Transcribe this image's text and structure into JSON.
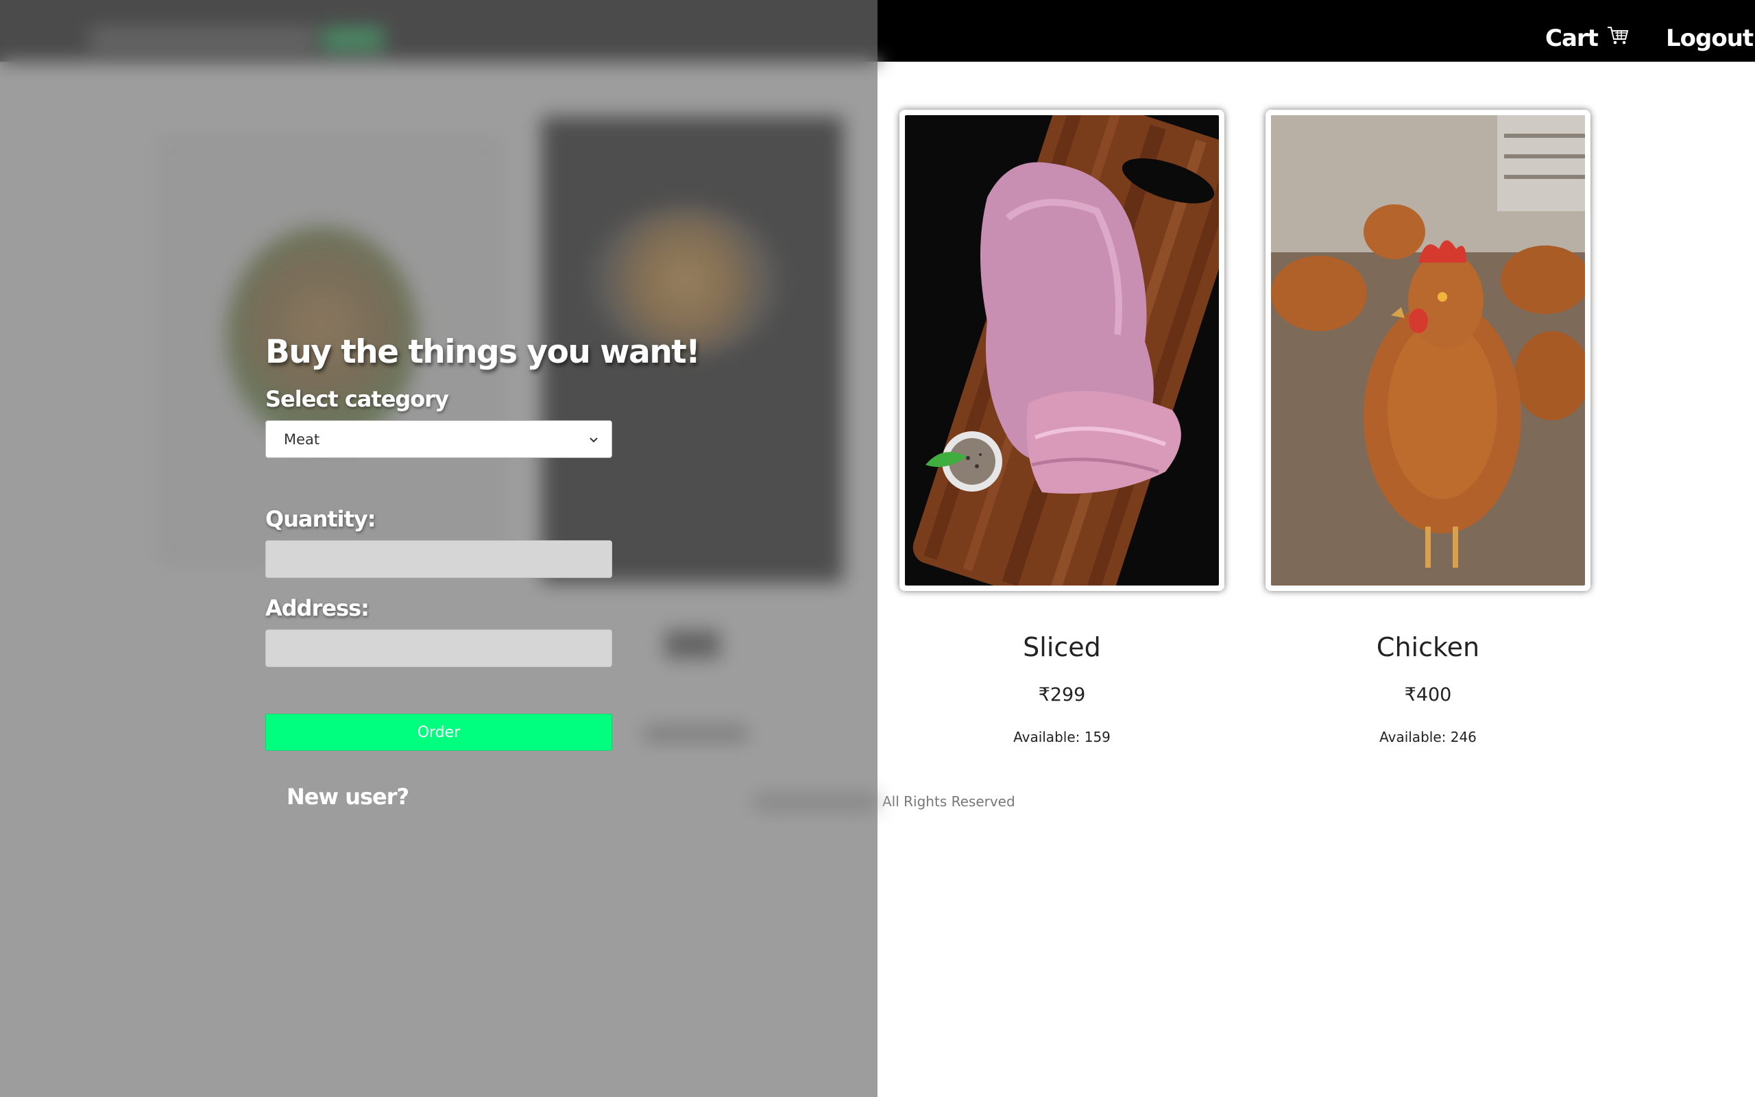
{
  "header": {
    "cart_label": "Cart",
    "logout_label": "Logout"
  },
  "products": [
    {
      "name": "Sliced",
      "price": "₹299",
      "availability": "Available: 159"
    },
    {
      "name": "Chicken",
      "price": "₹400",
      "availability": "Available: 246"
    }
  ],
  "footer": {
    "text": "All Rights Reserved"
  },
  "order_form": {
    "title": "Buy the things you want!",
    "category_label": "Select category",
    "category_selected": "Meat",
    "quantity_label": "Quantity:",
    "address_label": "Address:",
    "order_button": "Order",
    "new_user_link": "New user?"
  },
  "colors": {
    "topbar": "#000000",
    "order_button": "#00ff7f",
    "overlay": "rgba(110,110,110,0.68)"
  },
  "icons": {
    "cart": "shopping-cart-icon",
    "dropdown": "chevron-down-icon"
  }
}
